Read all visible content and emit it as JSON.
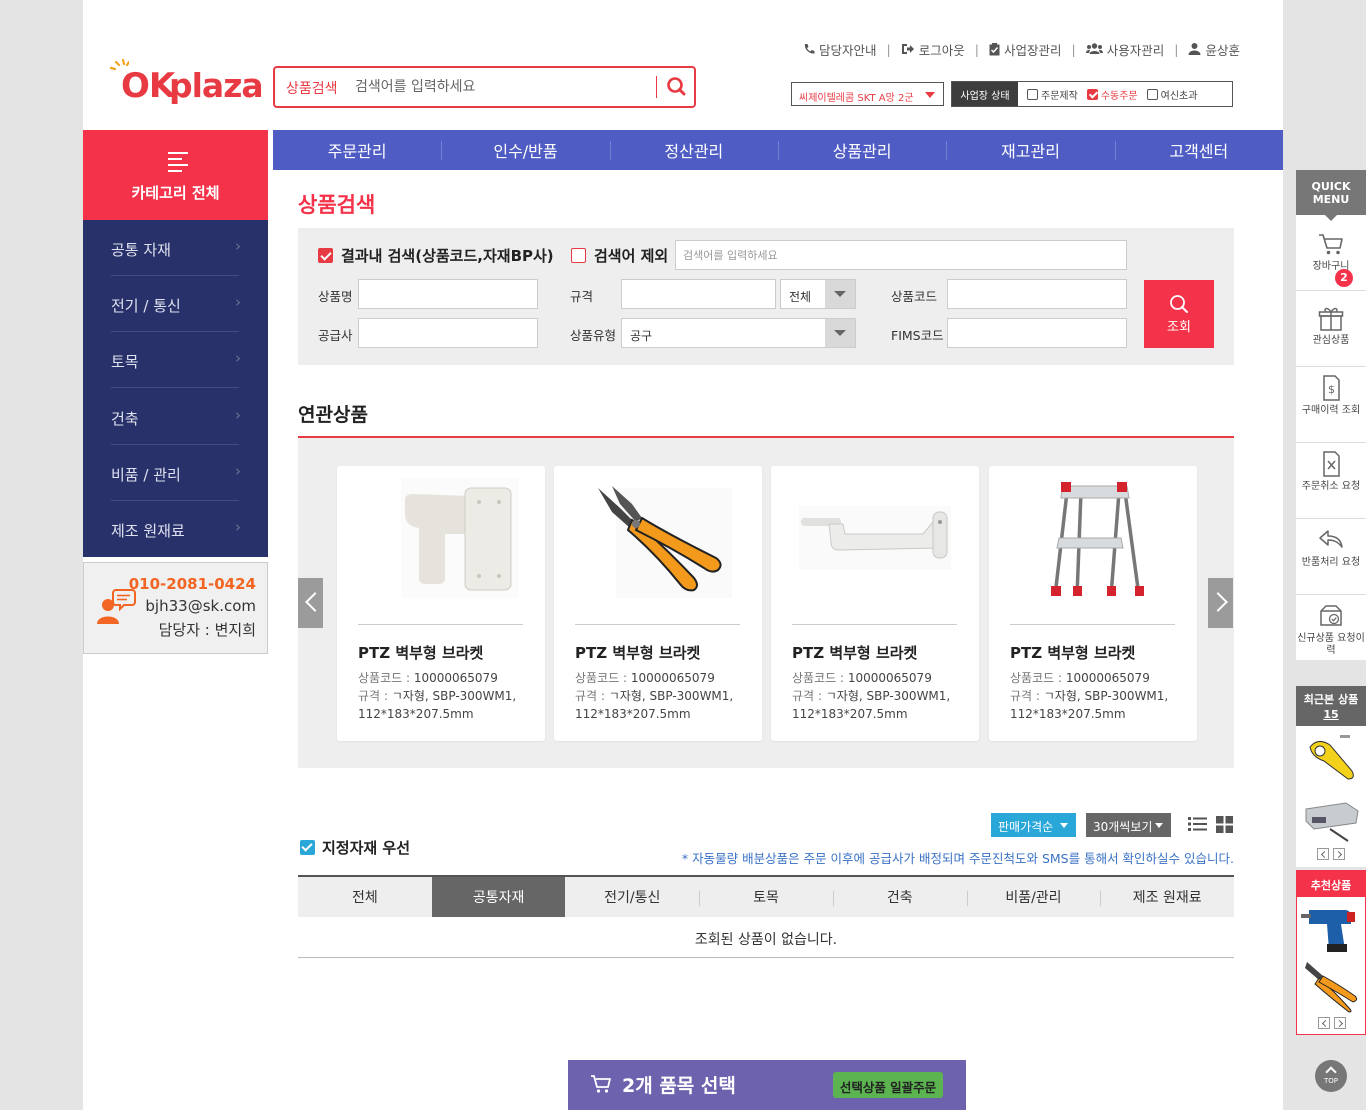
{
  "header": {
    "logo_ok": "OK",
    "logo_plaza": "plaza",
    "search_label": "상품검색",
    "search_placeholder": "검색어를 입력하세요",
    "top_links": [
      "담당자안내",
      "로그아웃",
      "사업장관리",
      "사용자관리",
      "윤상훈"
    ],
    "biz_select": "씨제이텔레콤 SKT A망 2군",
    "biz_state_label": "사업장 상태",
    "biz_state_options": [
      {
        "label": "주문제작",
        "checked": false
      },
      {
        "label": "수동주문",
        "checked": true
      },
      {
        "label": "여신초과",
        "checked": false
      }
    ]
  },
  "sidebar": {
    "category_all": "카테고리 전체",
    "items": [
      "공통 자재",
      "전기 / 통신",
      "토목",
      "건축",
      "비품 / 관리",
      "제조 원재료"
    ],
    "contact": {
      "phone": "010-2081-0424",
      "email": "bjh33@sk.com",
      "manager": "담당자 : 변지희"
    }
  },
  "gnb": [
    "주문관리",
    "인수/반품",
    "정산관리",
    "상품관리",
    "재고관리",
    "고객센터"
  ],
  "search_panel": {
    "title": "상품검색",
    "in_result": "결과내 검색(상품코드,자재BP사)",
    "in_result_checked": true,
    "exclude": "검색어 제외",
    "exclude_checked": false,
    "exclude_placeholder": "검색어를 입력하세요",
    "labels": {
      "name": "상품명",
      "spec": "규격",
      "code": "상품코드",
      "supplier": "공급사",
      "type": "상품유형",
      "fims": "FIMS코드"
    },
    "spec_select": "전체",
    "type_select": "공구",
    "submit": "조회"
  },
  "related": {
    "title": "연관상품",
    "code_label": "상품코드 : ",
    "spec_label": "규격 : ",
    "products": [
      {
        "name": "PTZ 벽부형 브라켓",
        "code": "10000065079",
        "spec": "ㄱ자형, SBP-300WM1, 112*183*207.5mm",
        "image": "wall-bracket-image"
      },
      {
        "name": "PTZ 벽부형 브라켓",
        "code": "10000065079",
        "spec": "ㄱ자형, SBP-300WM1, 112*183*207.5mm",
        "image": "crimping-plier-image"
      },
      {
        "name": "PTZ 벽부형 브라켓",
        "code": "10000065079",
        "spec": "ㄱ자형, SBP-300WM1, 112*183*207.5mm",
        "image": "arm-bracket-image"
      },
      {
        "name": "PTZ 벽부형 브라켓",
        "code": "10000065079",
        "spec": "ㄱ자형, SBP-300WM1, 112*183*207.5mm",
        "image": "step-ladder-image"
      }
    ]
  },
  "list": {
    "sort": "판매가격순",
    "count": "30개씩보기",
    "preferred": "지정자재 우선",
    "notice": "* 자동물량 배분상품은 주문 이후에 공급사가 배정되며 주문진척도와 SMS를 통해서 확인하실수 있습니다.",
    "tabs": [
      "전체",
      "공통자재",
      "전기/통신",
      "토목",
      "건축",
      "비품/관리",
      "제조 원재료"
    ],
    "active_tab": "공통자재",
    "empty": "조회된 상품이 없습니다."
  },
  "bottom_bar": {
    "label": "2개 품목 선택",
    "button": "선택상품 일괄주문"
  },
  "quick_menu": {
    "title_line1": "QUICK",
    "title_line2": "MENU",
    "cart_count": "2",
    "items": [
      "장바구니",
      "관심상품",
      "구매이력 조회",
      "주문취소 요청",
      "반품처리 요청",
      "신규상품 요청이력"
    ],
    "recent_title": "최근본 상품",
    "recent_count": "15",
    "recommend_title": "추천상품",
    "top": "TOP"
  },
  "colors": {
    "brand_red": "#f4334a",
    "nav_blue": "#4f5cc4",
    "sidebar_navy": "#283169",
    "accent_blue": "#2aa7d9"
  }
}
